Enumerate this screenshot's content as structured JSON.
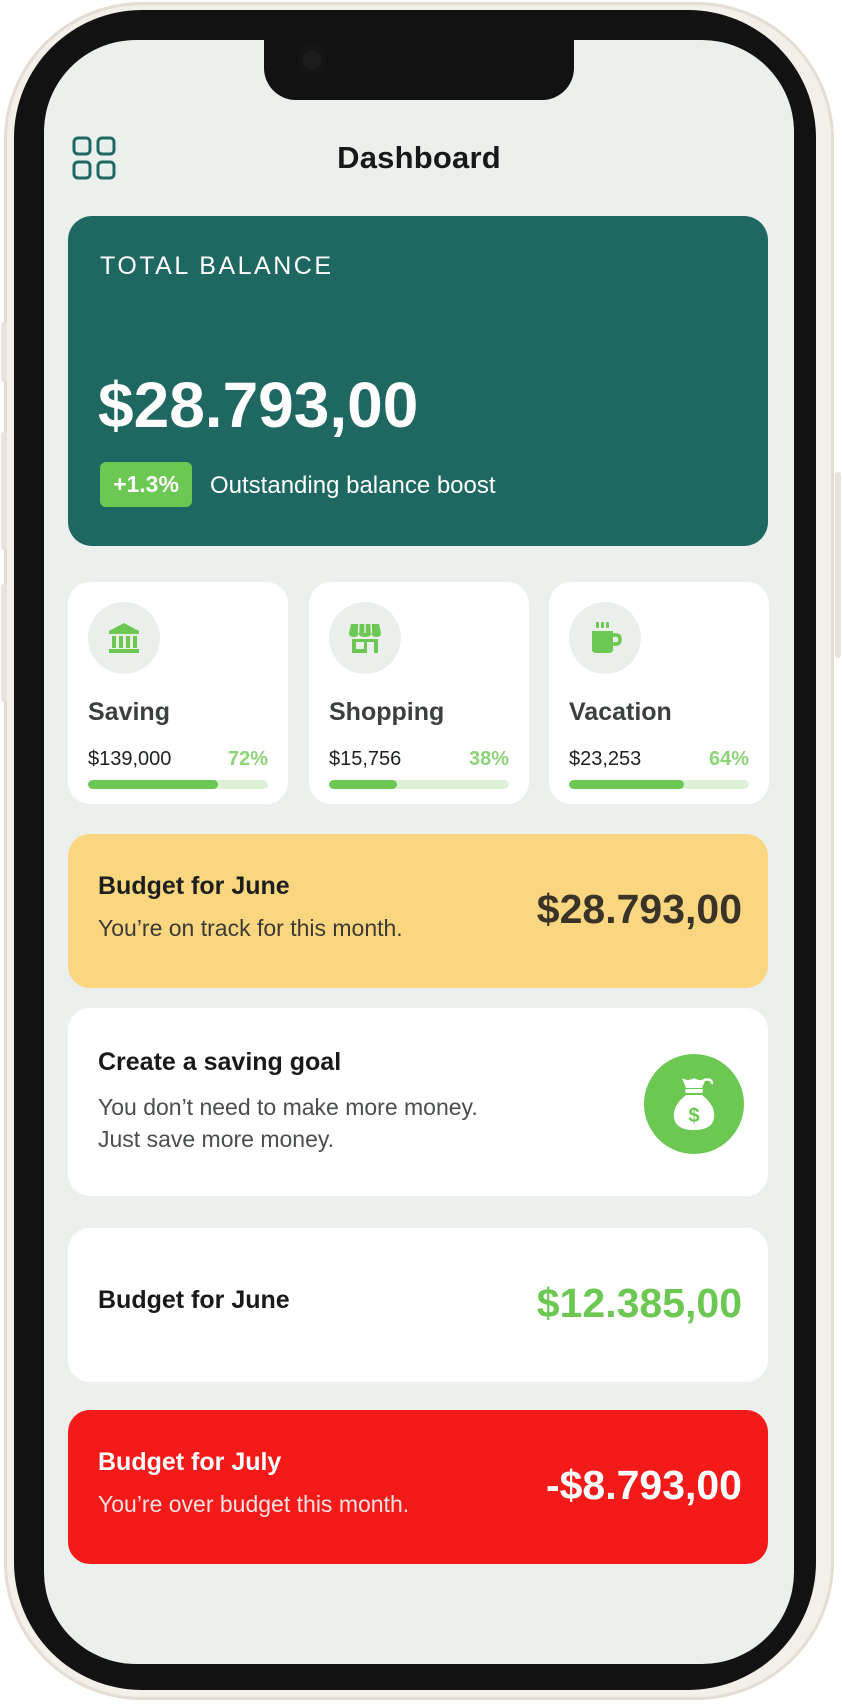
{
  "header": {
    "title": "Dashboard",
    "menu_icon": "grid-menu-icon"
  },
  "balance": {
    "label": "TOTAL BALANCE",
    "amount": "$28.793,00",
    "change_badge": "+1.3%",
    "change_text": "Outstanding balance boost"
  },
  "categories": [
    {
      "name": "Saving",
      "amount": "$139,000",
      "percent": "72%",
      "progress": 0.72,
      "icon": "bank-icon"
    },
    {
      "name": "Shopping",
      "amount": "$15,756",
      "percent": "38%",
      "progress": 0.38,
      "icon": "store-icon"
    },
    {
      "name": "Vacation",
      "amount": "$23,253",
      "percent": "64%",
      "progress": 0.64,
      "icon": "mug-icon"
    }
  ],
  "budget_june_primary": {
    "title": "Budget for June",
    "subtitle": "You’re on track for this month.",
    "amount": "$28.793,00"
  },
  "saving_goal": {
    "title": "Create a saving goal",
    "line1": "You don’t need to make more money.",
    "line2": "Just save more money.",
    "icon": "money-bag-icon"
  },
  "budget_june_secondary": {
    "title": "Budget for June",
    "amount": "$12.385,00"
  },
  "budget_july": {
    "title": "Budget for July",
    "subtitle": "You’re over budget this month.",
    "amount": "-$8.793,00"
  },
  "colors": {
    "primary_teal": "#1f6862",
    "accent_green": "#6cc852",
    "light_green": "#8fd378",
    "track_green": "#dcf1d6",
    "warning_yellow": "#fad681",
    "danger_red": "#f41a19",
    "screen_bg": "#ecf0ec"
  }
}
